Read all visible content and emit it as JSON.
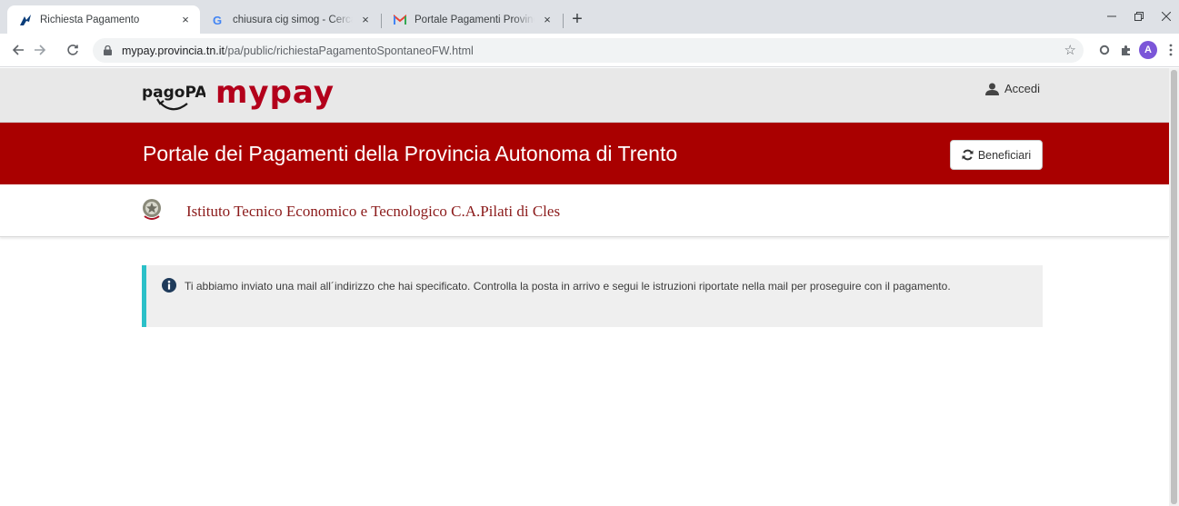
{
  "browser": {
    "tabs": [
      {
        "title": "Richiesta Pagamento",
        "icon": "mypay-favicon",
        "active": true
      },
      {
        "title": "chiusura cig simog - Cerca con Google",
        "icon": "google-favicon",
        "active": false
      },
      {
        "title": "Portale Pagamenti Provincia autonoma",
        "icon": "gmail-favicon",
        "active": false
      }
    ],
    "close_glyph": "×",
    "new_tab_glyph": "+",
    "url_host": "mypay.provincia.tn.it",
    "url_path": "/pa/public/richiestaPagamentoSpontaneoFW.html",
    "profile_initial": "A",
    "colors": {
      "tabstrip": "#dee1e6",
      "profile": "#7b56d8"
    }
  },
  "header": {
    "logo_pagopa": "pagoPA",
    "logo_mypay": "mypay",
    "login_label": "Accedi"
  },
  "banner": {
    "title": "Portale dei Pagamenti della Provincia Autonoma di Trento",
    "beneficiari_label": "Beneficiari",
    "color": "#a90000"
  },
  "ente": {
    "name": "Istituto Tecnico Economico e Tecnologico C.A.Pilati di Cles"
  },
  "alert": {
    "message": "Ti abbiamo inviato una mail all´indirizzo che hai specificato. Controlla la posta in arrivo e segui le istruzioni riportate nella mail per proseguire con il pagamento.",
    "accent": "#2bc0c8"
  }
}
